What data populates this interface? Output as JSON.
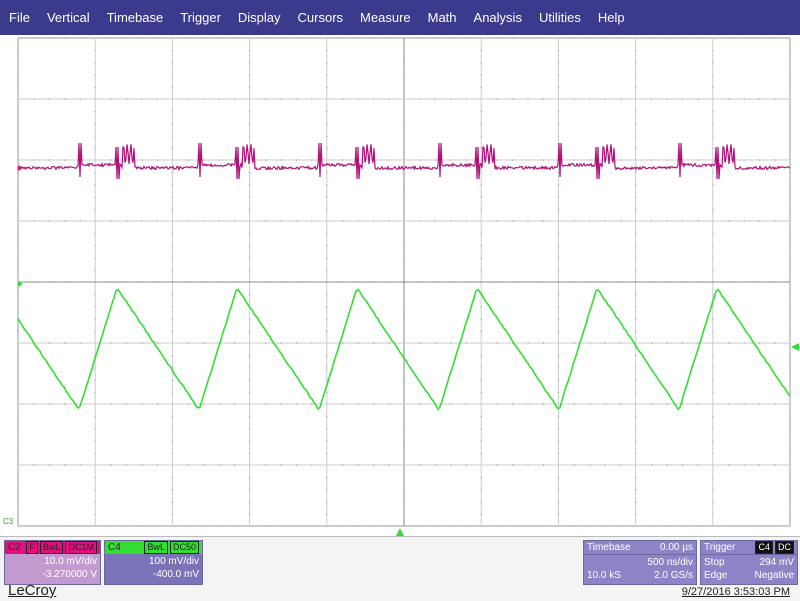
{
  "menu": {
    "items": [
      "File",
      "Vertical",
      "Timebase",
      "Trigger",
      "Display",
      "Cursors",
      "Measure",
      "Math",
      "Analysis",
      "Utilities",
      "Help"
    ]
  },
  "screen": {
    "ground_marker_label": "C3",
    "grid": {
      "hdiv": 10,
      "vdiv": 8
    }
  },
  "channels": {
    "c2": {
      "name": "C2",
      "tags": [
        "F",
        "BwL",
        "DC1M"
      ],
      "scale": "10.0 mV/div",
      "offset": "-3.270000 V",
      "color": "#e0107c"
    },
    "c4": {
      "name": "C4",
      "tags": [
        "BwL",
        "DC50"
      ],
      "scale": "100 mV/div",
      "offset": "-400.0 mV",
      "color": "#33dd33"
    }
  },
  "timebase": {
    "label": "Timebase",
    "delay": "0.00 µs",
    "scale": "500 ns/div",
    "points": "10.0 kS",
    "rate": "2.0 GS/s"
  },
  "trigger": {
    "label": "Trigger",
    "source_tag": "C4",
    "coupling_tag": "DC",
    "mode": "Stop",
    "level": "294 mV",
    "type": "Edge",
    "slope": "Negative"
  },
  "footer": {
    "brand": "LeCroy",
    "timestamp": "9/27/2016 3:53:03 PM"
  },
  "colors": {
    "menu_bg": "#3c3a8c",
    "c2": "#b0107a",
    "c4": "#33dd33"
  }
}
